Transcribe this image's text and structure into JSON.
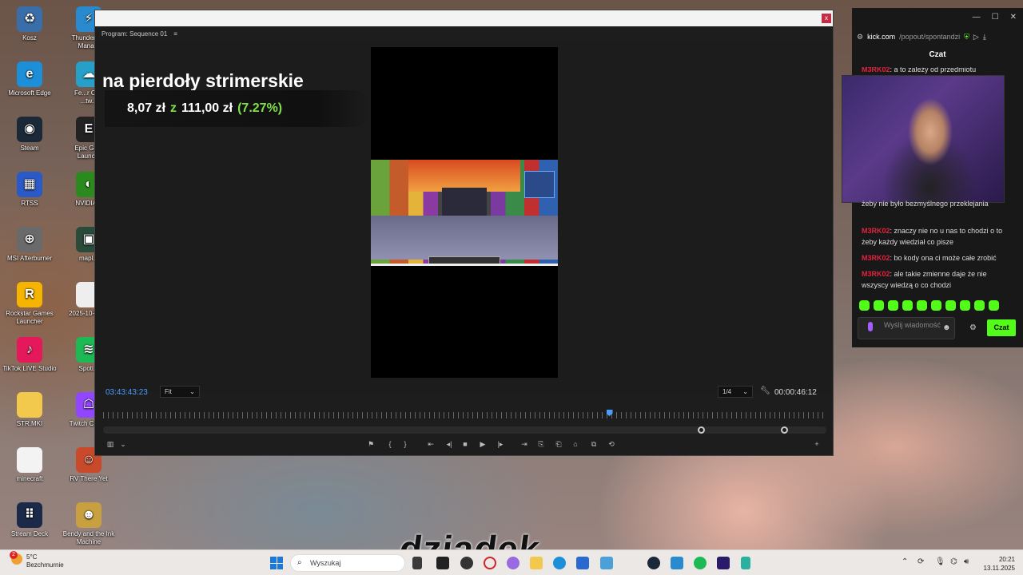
{
  "wallpaper": {
    "caption": "dziadek"
  },
  "desktop_icons": [
    {
      "label": "Kosz",
      "color": "#3a6ea8",
      "glyph": "♻"
    },
    {
      "label": "Thunderst...\nMana...",
      "color": "#2a8ad0",
      "glyph": "⚡"
    },
    {
      "label": "Microsoft Edge",
      "color": "#1c8fd8",
      "glyph": "e"
    },
    {
      "label": "Fe...r Ot...\n...tw...",
      "color": "#26a0c8",
      "glyph": "☁"
    },
    {
      "label": "Steam",
      "color": "#1b2838",
      "glyph": "◉"
    },
    {
      "label": "Epic Ga...\nLaunc...",
      "color": "#222222",
      "glyph": "E"
    },
    {
      "label": "RTSS",
      "color": "#2a5ac8",
      "glyph": "▦"
    },
    {
      "label": "NVIDIA...",
      "color": "#2b8a1e",
      "glyph": "◐"
    },
    {
      "label": "MSI Afterburner",
      "color": "#6a6a6a",
      "glyph": "⊕"
    },
    {
      "label": "mapl...",
      "color": "#2a4a3a",
      "glyph": "▣"
    },
    {
      "label": "Rockstar Games\nLauncher",
      "color": "#f5b400",
      "glyph": "R"
    },
    {
      "label": "2025-10-01 ...",
      "color": "#eeeeee",
      "glyph": ""
    },
    {
      "label": "TikTok LIVE Studio",
      "color": "#e4185a",
      "glyph": "♪"
    },
    {
      "label": "Spoti...",
      "color": "#1db954",
      "glyph": "≋"
    },
    {
      "label": "STR.MKI",
      "color": "#f2c94c",
      "glyph": ""
    },
    {
      "label": "Twitch Chat...",
      "color": "#9146ff",
      "glyph": "☖"
    },
    {
      "label": "minecraft",
      "color": "#f3f3f3",
      "glyph": ""
    },
    {
      "label": "RV There Yet",
      "color": "#c84a2a",
      "glyph": "☺"
    },
    {
      "label": "Stream Deck",
      "color": "#1c2a4a",
      "glyph": "⠿"
    },
    {
      "label": "Bendy and the Ink\nMachine",
      "color": "#c8a040",
      "glyph": "☻"
    }
  ],
  "premiere": {
    "panel_title": "Program: Sequence 01",
    "panel_menu": "≡",
    "close_label": "x",
    "overlay_title": "na pierdoły strimerskie",
    "overlay_amount": "8,07 zł",
    "overlay_of": "z",
    "overlay_goal": "111,00 zł",
    "overlay_percent": "(7.27%)",
    "timecode_current": "03:43:43:23",
    "zoom_value": "Fit",
    "resolution_value": "1/4",
    "timecode_duration": "00:00:46:12",
    "playhead_fraction": 0.7,
    "controls": [
      "▥",
      "⌄",
      "⚑",
      "{",
      "}",
      "⇤",
      "◂|",
      "■",
      "▶",
      "|▸",
      "⇥",
      "⎘",
      "⎗",
      "⌂",
      "⧉",
      "⟲",
      "+"
    ]
  },
  "kick": {
    "window_controls": [
      "—",
      "☐",
      "✕"
    ],
    "url_host": "kick.com",
    "url_path": "/popout/spontandzi",
    "header": "Czat",
    "messages": [
      {
        "user": "M3RK02",
        "text": ": a to zależy od przedmiotu"
      },
      {
        "user": "",
        "text": "żeby nie było bezmyślnego przeklejania"
      },
      {
        "user": "M3RK02",
        "text": ": znaczy nie no u nas to chodzi o to żeby każdy wiedział co pisze"
      },
      {
        "user": "M3RK02",
        "text": ": bo kody ona ci może całe zrobić"
      },
      {
        "user": "M3RK02",
        "text": ": ale takie zmienne daje że nie wszyscy wiedzą o co chodzi"
      }
    ],
    "input_placeholder": "Wyślij wiadomość",
    "send_label": "Czat",
    "accent_color": "#53fc18"
  },
  "taskbar": {
    "weather_temp": "5°C",
    "weather_desc": "Bezchmurnie",
    "weather_badge": "2",
    "search_placeholder": "Wyszukaj",
    "time": "20:21",
    "date": "13.11.2025"
  }
}
